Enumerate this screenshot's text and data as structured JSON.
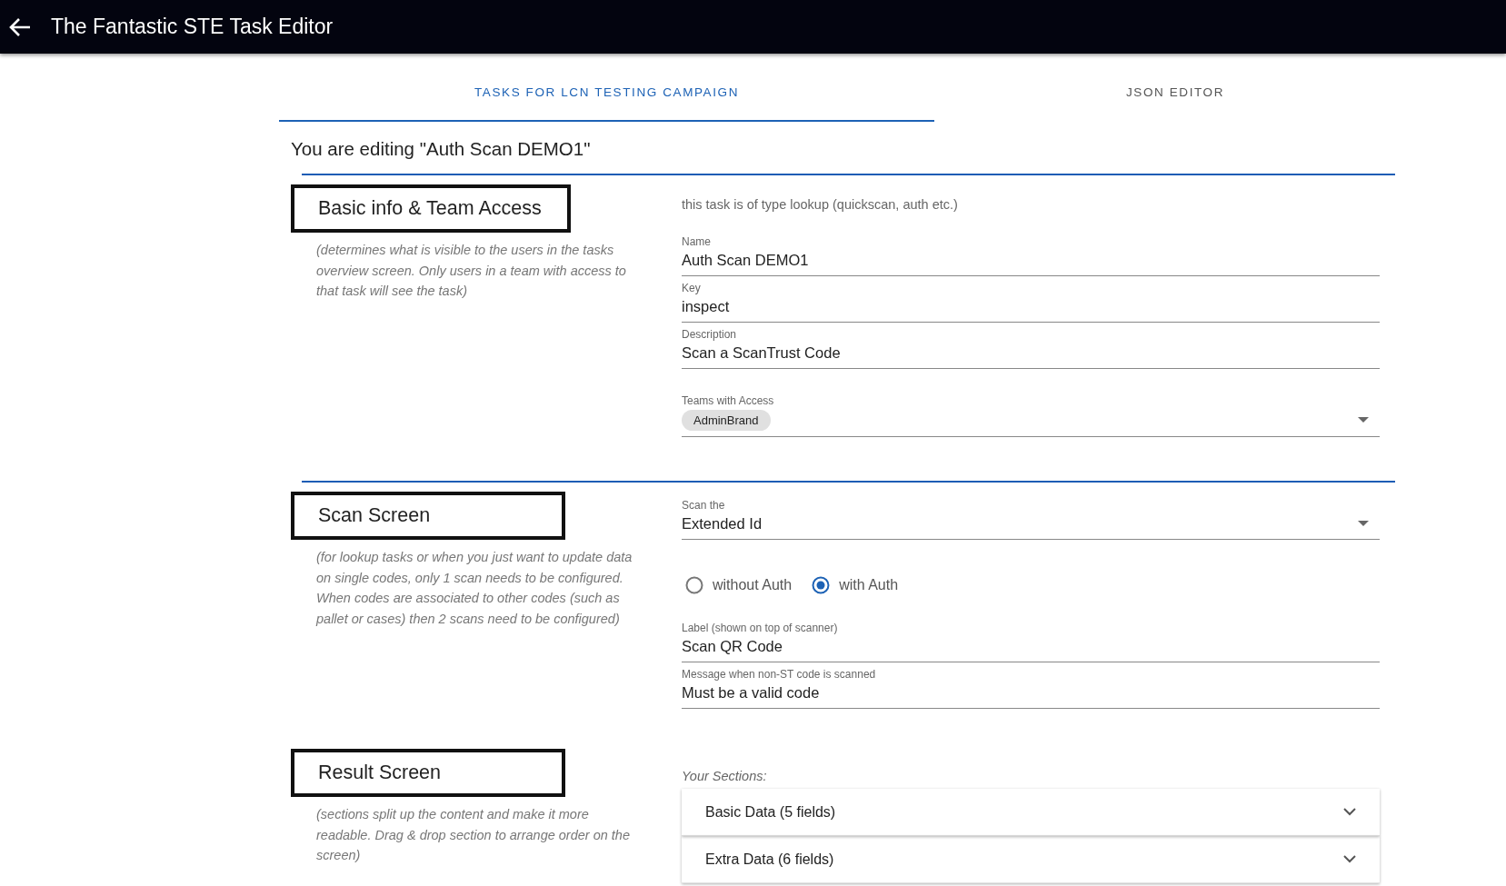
{
  "app_bar": {
    "title": "The Fantastic STE Task Editor"
  },
  "tabs": [
    {
      "label": "TASKS FOR LCN TESTING CAMPAIGN",
      "selected": true
    },
    {
      "label": "JSON EDITOR",
      "selected": false
    }
  ],
  "heading": "You are editing \"Auth Scan DEMO1\"",
  "sections": [
    {
      "title": "Basic info & Team Access",
      "divider": true,
      "description": "(determines what is visible to the users in the tasks overview screen. Only users in a team with access to that task will see the task)",
      "items": [
        {
          "kind": "note",
          "text": "this task is of type lookup (quickscan, auth etc.)"
        },
        {
          "kind": "text",
          "label": "Name",
          "value": "Auth Scan DEMO1"
        },
        {
          "kind": "text",
          "label": "Key",
          "value": "inspect"
        },
        {
          "kind": "text",
          "label": "Description",
          "value": "Scan a ScanTrust Code"
        },
        {
          "kind": "chips",
          "label": "Teams with Access",
          "chips": [
            "AdminBrand"
          ]
        }
      ]
    },
    {
      "title": "Scan Screen",
      "divider": true,
      "description": "(for lookup tasks or when you just want to update data on single codes, only 1 scan needs to be configured. When codes are associated to other codes (such as pallet or cases) then 2 scans need to be configured)",
      "items": [
        {
          "kind": "select",
          "label": "Scan the",
          "value": "Extended Id"
        },
        {
          "kind": "radios",
          "options": [
            {
              "label": "without Auth",
              "selected": false
            },
            {
              "label": "with Auth",
              "selected": true
            }
          ]
        },
        {
          "kind": "text",
          "label": "Label (shown on top of scanner)",
          "value": "Scan QR Code"
        },
        {
          "kind": "text",
          "label": "Message when non-ST code is scanned",
          "value": "Must be a valid code"
        }
      ]
    },
    {
      "title": "Result Screen",
      "divider": false,
      "description": "(sections split up the content and make it more readable. Drag & drop section to arrange order on the screen)",
      "items": [
        {
          "kind": "panels",
          "label": "Your Sections:",
          "panels": [
            "Basic Data (5 fields)",
            "Extra Data (6 fields)"
          ]
        }
      ]
    }
  ]
}
